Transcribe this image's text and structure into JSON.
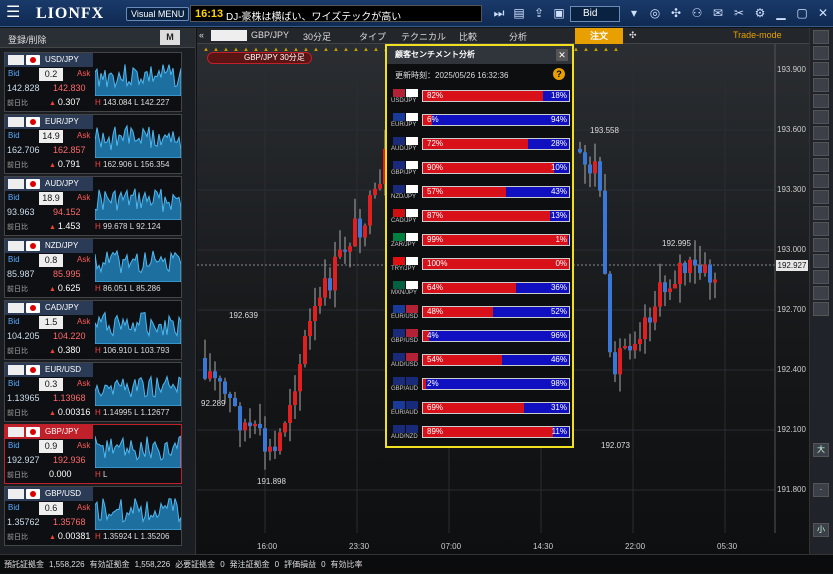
{
  "topbar": {
    "logo": "LIONFX",
    "visual_menu": "Visual MENU",
    "news_time": "16:13",
    "news_text": "DJ-豪株は横ばい、ワイズテックが高い",
    "bid_select": "Bid"
  },
  "left_panel": {
    "register_label": "登録/削除",
    "m_button": "M",
    "prev_label": "前日比",
    "bid_label": "Bid",
    "ask_label": "Ask",
    "pairs": [
      {
        "name": "USD/JPY",
        "spread": "0.2",
        "bid": "142.828",
        "ask": "142.830",
        "change": "0.307",
        "high": "143.084",
        "low": "142.227",
        "up": true
      },
      {
        "name": "EUR/JPY",
        "spread": "14.9",
        "bid": "162.706",
        "ask": "162.857",
        "change": "0.791",
        "high": "162.906",
        "low": "156.354",
        "up": true
      },
      {
        "name": "AUD/JPY",
        "spread": "18.9",
        "bid": "93.963",
        "ask": "94.152",
        "change": "1.453",
        "high": "99.678",
        "low": "92.124",
        "up": true
      },
      {
        "name": "NZD/JPY",
        "spread": "0.8",
        "bid": "85.987",
        "ask": "85.995",
        "change": "0.625",
        "high": "86.051",
        "low": "85.286",
        "up": true
      },
      {
        "name": "CAD/JPY",
        "spread": "1.5",
        "bid": "104.205",
        "ask": "104.220",
        "change": "0.380",
        "high": "106.910",
        "low": "103.793",
        "up": true
      },
      {
        "name": "EUR/USD",
        "spread": "0.3",
        "bid": "1.13965",
        "ask": "1.13968",
        "change": "0.00316",
        "high": "1.14995",
        "low": "1.12677",
        "up": true
      },
      {
        "name": "GBP/JPY",
        "spread": "0.9",
        "bid": "192.927",
        "ask": "192.936",
        "change": "0.000",
        "high": "",
        "low": "",
        "up": false
      },
      {
        "name": "GBP/USD",
        "spread": "0.6",
        "bid": "1.35762",
        "ask": "1.35768",
        "change": "0.00381",
        "high": "1.35924",
        "low": "1.35206",
        "up": true
      }
    ]
  },
  "chart": {
    "pair": "GBP/JPY",
    "interval": "30分足",
    "menu": [
      "タイプ",
      "テクニカル",
      "比較",
      "分析"
    ],
    "order_tab": "注文",
    "mode": "Trade-mode",
    "chip": "GBP/JPY 30分足",
    "price_now": "192.927",
    "y_ticks": [
      "193.900",
      "193.600",
      "193.300",
      "193.000",
      "192.700",
      "192.400",
      "192.100",
      "191.800"
    ],
    "x_ticks": [
      "16:00",
      "23:30",
      "07:00",
      "14:30",
      "22:00",
      "05:30"
    ],
    "annotations": [
      "192.639",
      "92.289",
      "191.898",
      "193.558",
      "192.995",
      "192.073"
    ]
  },
  "sentiment": {
    "title": "顧客センチメント分析",
    "updated": "更新時刻：2025/05/26 16:32:36",
    "help": "?",
    "rows": [
      {
        "pair": "USD/JPY",
        "left": 82,
        "right": 18,
        "c1": "#b22234",
        "c2": "#ffffff"
      },
      {
        "pair": "EUR/JPY",
        "left": 6,
        "right": 94,
        "c1": "#1a3a9a",
        "c2": "#ffffff"
      },
      {
        "pair": "AUD/JPY",
        "left": 72,
        "right": 28,
        "c1": "#1a2a7a",
        "c2": "#ffffff"
      },
      {
        "pair": "GBP/JPY",
        "left": 90,
        "right": 10,
        "c1": "#1a2a7a",
        "c2": "#ffffff"
      },
      {
        "pair": "NZD/JPY",
        "left": 57,
        "right": 43,
        "c1": "#1a2a7a",
        "c2": "#ffffff"
      },
      {
        "pair": "CAD/JPY",
        "left": 87,
        "right": 13,
        "c1": "#d01010",
        "c2": "#ffffff"
      },
      {
        "pair": "ZAR/JPY",
        "left": 99,
        "right": 1,
        "c1": "#008040",
        "c2": "#ffffff"
      },
      {
        "pair": "TRY/JPY",
        "left": 100,
        "right": 0,
        "c1": "#e01010",
        "c2": "#ffffff"
      },
      {
        "pair": "MXN/JPY",
        "left": 64,
        "right": 36,
        "c1": "#006040",
        "c2": "#ffffff"
      },
      {
        "pair": "EUR/USD",
        "left": 48,
        "right": 52,
        "c1": "#1a3a9a",
        "c2": "#b22234"
      },
      {
        "pair": "GBP/USD",
        "left": 4,
        "right": 96,
        "c1": "#1a2a7a",
        "c2": "#b22234"
      },
      {
        "pair": "AUD/USD",
        "left": 54,
        "right": 46,
        "c1": "#1a2a7a",
        "c2": "#b22234"
      },
      {
        "pair": "GBP/AUD",
        "left": 2,
        "right": 98,
        "c1": "#1a2a7a",
        "c2": "#1a2a7a"
      },
      {
        "pair": "EUR/AUD",
        "left": 69,
        "right": 31,
        "c1": "#1a3a9a",
        "c2": "#1a2a7a"
      },
      {
        "pair": "AUD/NZD",
        "left": 89,
        "right": 11,
        "c1": "#1a2a7a",
        "c2": "#1a2a7a"
      }
    ]
  },
  "status": {
    "items": [
      "預託証拠金",
      "1,558,226",
      "有効証拠金",
      "1,558,226",
      "必要証拠金",
      "0",
      "発注証拠金",
      "0",
      "評価損益",
      "0",
      "有効比率"
    ]
  },
  "colors": {
    "accent": "#e8a000",
    "sell": "#d8101a",
    "buy": "#1010c0",
    "highlight": "#f0e020"
  }
}
